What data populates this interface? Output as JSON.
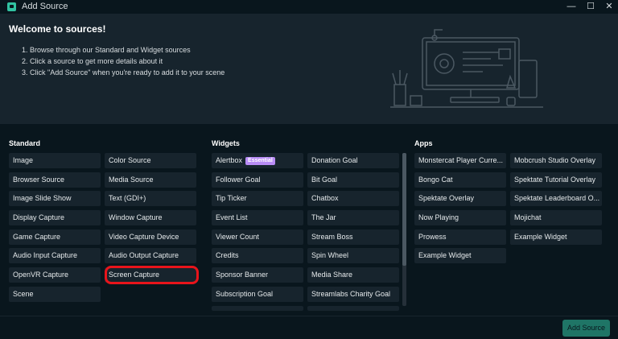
{
  "window": {
    "title": "Add Source",
    "minimize_glyph": "—",
    "maximize_glyph": "☐",
    "close_glyph": "✕"
  },
  "welcome": {
    "heading": "Welcome to sources!",
    "steps": [
      "1. Browse through our Standard and Widget sources",
      "2. Click a source to get more details about it",
      "3. Click \"Add Source\" when you're ready to add it to your scene"
    ]
  },
  "standard": {
    "title": "Standard",
    "items": [
      "Image",
      "Color Source",
      "Browser Source",
      "Media Source",
      "Image Slide Show",
      "Text (GDI+)",
      "Display Capture",
      "Window Capture",
      "Game Capture",
      "Video Capture Device",
      "Audio Input Capture",
      "Audio Output Capture",
      "OpenVR Capture",
      "Screen Capture",
      "Scene"
    ]
  },
  "widgets": {
    "title": "Widgets",
    "items": [
      "Alertbox",
      "Donation Goal",
      "Follower Goal",
      "Bit Goal",
      "Tip Ticker",
      "Chatbox",
      "Event List",
      "The Jar",
      "Viewer Count",
      "Stream Boss",
      "Credits",
      "Spin Wheel",
      "Sponsor Banner",
      "Media Share",
      "Subscription Goal",
      "Streamlabs Charity Goal"
    ],
    "badge": "Essential"
  },
  "apps": {
    "title": "Apps",
    "items": [
      "Monstercat Player Curre...",
      "Mobcrush Studio Overlay",
      "Bongo Cat",
      "Spektate Tutorial Overlay",
      "Spektate Overlay",
      "Spektate Leaderboard O...",
      "Now Playing",
      "Mojichat",
      "Prowess",
      "Example Widget",
      "Example Widget"
    ]
  },
  "footer": {
    "add_source_label": "Add Source"
  },
  "colors": {
    "background": "#09161d",
    "panel": "#17242d",
    "accent": "#31c3a2",
    "badge": "#b88cf5",
    "highlight": "#e8141b"
  }
}
